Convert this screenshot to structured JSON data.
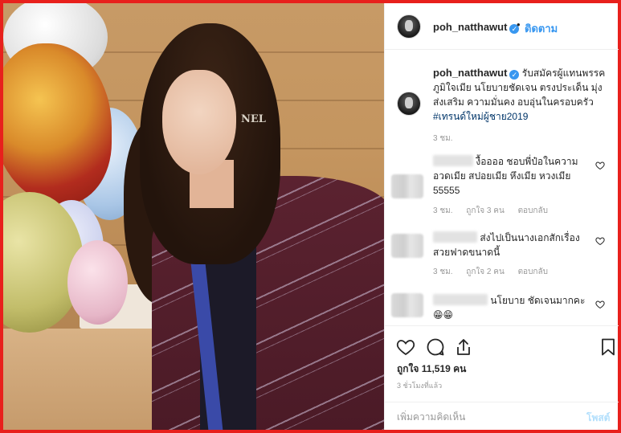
{
  "header": {
    "username": "poh_natthawut",
    "follow_label": "ติดตาม",
    "separator": "•"
  },
  "caption": {
    "username": "poh_natthawut",
    "text": "รับสมัครผู้แทนพรรคภูมิใจเมีย นโยบายชัดเจน ตรงประเด็น มุ่งส่งเสริม ความมั่นคง อบอุ่นในครอบครัว",
    "hashtag": "#เทรนด์ใหม่ผู้ชาย2019",
    "time": "3 ชม."
  },
  "comments": [
    {
      "text": "งื้ออออ ชอบพี่ป๋อในความอวดเมีย สปอยเมีย หึงเมีย หวงเมีย 55555",
      "time": "3 ชม.",
      "likes": "ถูกใจ 3 คน",
      "reply": "ตอบกลับ"
    },
    {
      "text": "ส่งไปเป็นนางเอกสักเรื่อง สวยฟาดขนาดนี้",
      "time": "3 ชม.",
      "likes": "ถูกใจ 2 คน",
      "reply": "ตอบกลับ"
    },
    {
      "text": "นโยบาย ชัดเจนมากคะ",
      "emoji": "😁😁"
    }
  ],
  "photo": {
    "earring_letters": "NEL"
  },
  "actions": {
    "icons": [
      "heart-icon",
      "comment-icon",
      "share-icon",
      "bookmark-icon"
    ],
    "likes": "ถูกใจ 11,519 คน",
    "posted": "3 ชั่วโมงที่แล้ว"
  },
  "add_comment": {
    "placeholder": "เพิ่มความคิดเห็น",
    "post_label": "โพสต์"
  },
  "colors": {
    "frame": "#e8201c",
    "link": "#3897f0",
    "hashtag": "#003569",
    "muted": "#999999",
    "post_disabled": "#b2dffc"
  }
}
